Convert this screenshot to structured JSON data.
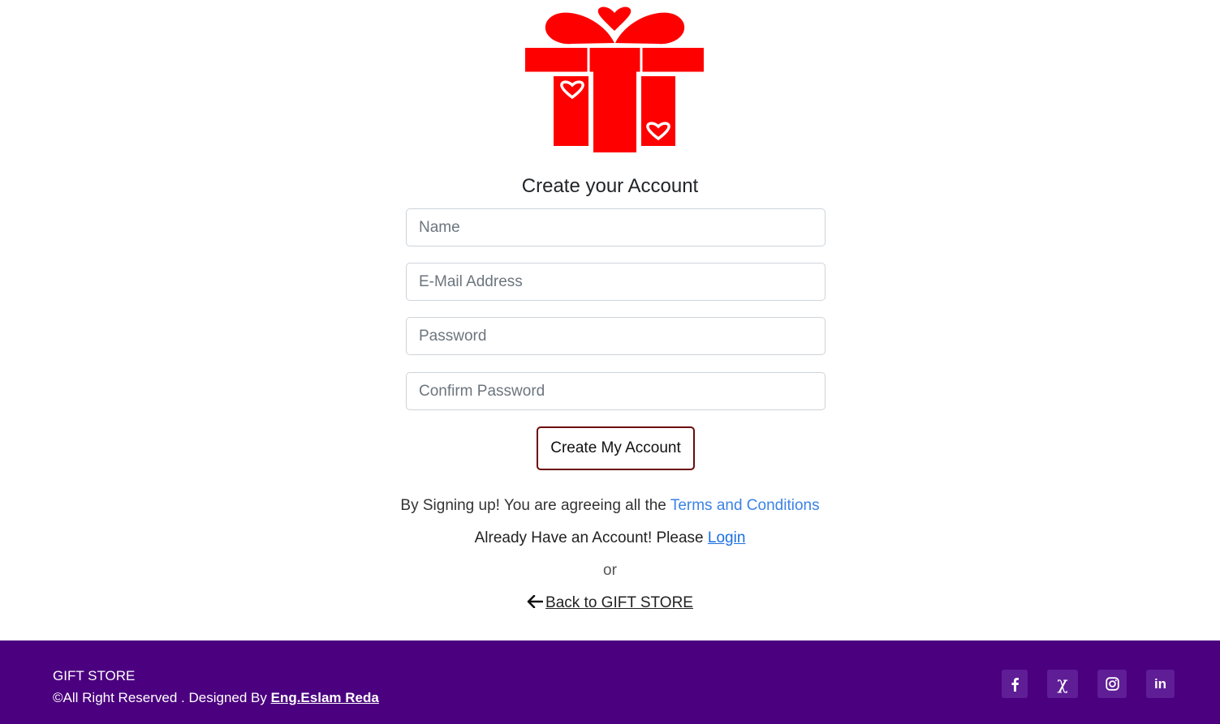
{
  "logo": {
    "name": "gift-box-logo",
    "color": "#ff0000"
  },
  "form": {
    "title": "Create your Account",
    "name_placeholder": "Name",
    "email_placeholder": "E-Mail Address",
    "password_placeholder": "Password",
    "confirm_placeholder": "Confirm Password",
    "submit_label": "Create My Account"
  },
  "terms": {
    "prefix": "By Signing up! You are agreeing all the ",
    "link": "Terms and Conditions"
  },
  "login": {
    "prefix": "Already Have an Account! Please ",
    "link": "Login"
  },
  "or_text": "or",
  "back": {
    "label": "Back to GIFT STORE",
    "icon": "arrow-left-icon"
  },
  "footer": {
    "brand": "GIFT STORE",
    "copyright_prefix": "©All Right Reserved . Designed By ",
    "designer": "Eng.Eslam Reda",
    "background": "#4b007f",
    "social": [
      {
        "icon": "facebook-icon",
        "glyph": "f"
      },
      {
        "icon": "x-twitter-icon",
        "glyph": "χ"
      },
      {
        "icon": "instagram-icon",
        "glyph": ""
      },
      {
        "icon": "linkedin-icon",
        "glyph": "in"
      }
    ]
  }
}
